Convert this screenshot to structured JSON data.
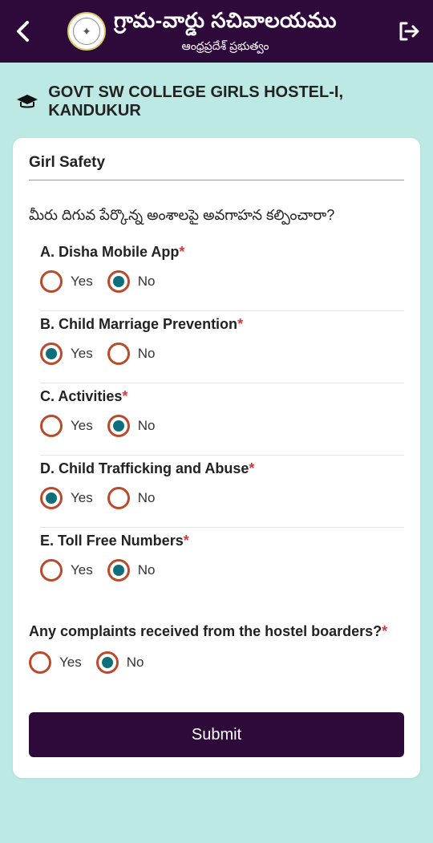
{
  "brand": {
    "title": "గ్రామ-వార్డు సచివాలయము",
    "subtitle": "ఆంధ్రప్రదేశ్ ప్రభుత్వం"
  },
  "page_title": "GOVT SW COLLEGE GIRLS HOSTEL-I, KANDUKUR",
  "section_title": "Girl Safety",
  "lead_question": "మీరు దిగువ పేర్కొన్న అంశాలపై అవగాహన కల్పించారా?",
  "options": {
    "yes": "Yes",
    "no": "No"
  },
  "questions": [
    {
      "label": "A. Disha Mobile App",
      "required": true,
      "value": "no"
    },
    {
      "label": "B. Child Marriage Prevention",
      "required": true,
      "value": "yes"
    },
    {
      "label": "C. Activities",
      "required": true,
      "value": "no"
    },
    {
      "label": "D. Child Trafficking and Abuse",
      "required": true,
      "value": "yes"
    },
    {
      "label": "E. Toll Free Numbers",
      "required": true,
      "value": "no"
    }
  ],
  "complaints": {
    "label": "Any complaints received from the hostel boarders?",
    "required": true,
    "value": "no"
  },
  "submit_label": "Submit"
}
